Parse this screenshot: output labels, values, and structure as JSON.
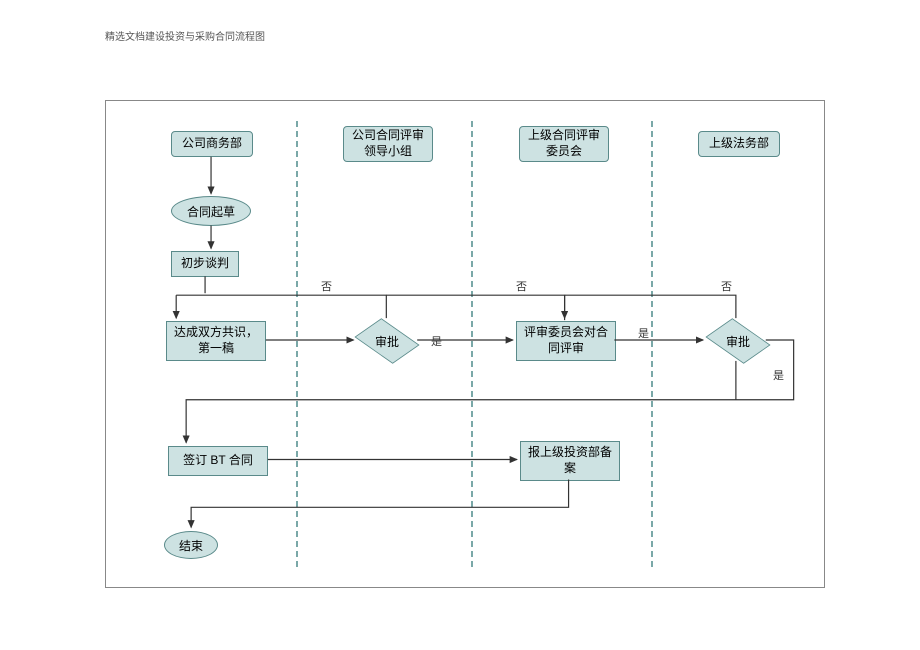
{
  "doc": {
    "title": "精选文档建设投资与采购合同流程图"
  },
  "lanes": {
    "l1": "公司商务部",
    "l2": "公司合同评审领导小组",
    "l3": "上级合同评审委员会",
    "l4": "上级法务部"
  },
  "nodes": {
    "start_draft": "合同起草",
    "initial_neg": "初步谈判",
    "consensus": "达成双方共识，第一稿",
    "approve1": "审批",
    "committee_review": "评审委员会对合同评审",
    "approve2": "审批",
    "sign_bt": "签订 BT 合同",
    "report_filing": "报上级投资部备案",
    "end": "结束"
  },
  "labels": {
    "yes": "是",
    "no": "否"
  },
  "chart_data": {
    "type": "flowchart",
    "title": "精选文档建设投资与采购合同流程图",
    "swimlanes": [
      {
        "id": "l1",
        "name": "公司商务部"
      },
      {
        "id": "l2",
        "name": "公司合同评审领导小组"
      },
      {
        "id": "l3",
        "name": "上级合同评审委员会"
      },
      {
        "id": "l4",
        "name": "上级法务部"
      }
    ],
    "nodes": [
      {
        "id": "lane1_head",
        "lane": "l1",
        "type": "lane-header",
        "label": "公司商务部"
      },
      {
        "id": "lane2_head",
        "lane": "l2",
        "type": "lane-header",
        "label": "公司合同评审领导小组"
      },
      {
        "id": "lane3_head",
        "lane": "l3",
        "type": "lane-header",
        "label": "上级合同评审委员会"
      },
      {
        "id": "lane4_head",
        "lane": "l4",
        "type": "lane-header",
        "label": "上级法务部"
      },
      {
        "id": "start_draft",
        "lane": "l1",
        "type": "terminator",
        "label": "合同起草"
      },
      {
        "id": "initial_neg",
        "lane": "l1",
        "type": "process",
        "label": "初步谈判"
      },
      {
        "id": "consensus",
        "lane": "l1",
        "type": "process",
        "label": "达成双方共识，第一稿"
      },
      {
        "id": "approve1",
        "lane": "l2",
        "type": "decision",
        "label": "审批"
      },
      {
        "id": "committee_review",
        "lane": "l3",
        "type": "process",
        "label": "评审委员会对合同评审"
      },
      {
        "id": "approve2",
        "lane": "l4",
        "type": "decision",
        "label": "审批"
      },
      {
        "id": "sign_bt",
        "lane": "l1",
        "type": "process",
        "label": "签订 BT 合同"
      },
      {
        "id": "report_filing",
        "lane": "l3",
        "type": "process",
        "label": "报上级投资部备案"
      },
      {
        "id": "end",
        "lane": "l1",
        "type": "terminator",
        "label": "结束"
      }
    ],
    "edges": [
      {
        "from": "lane1_head",
        "to": "start_draft"
      },
      {
        "from": "start_draft",
        "to": "initial_neg"
      },
      {
        "from": "initial_neg",
        "to": "consensus"
      },
      {
        "from": "consensus",
        "to": "approve1"
      },
      {
        "from": "approve1",
        "to": "committee_review",
        "label": "是"
      },
      {
        "from": "approve1",
        "to": "initial_neg",
        "label": "否"
      },
      {
        "from": "committee_review",
        "to": "approve2"
      },
      {
        "from": "committee_review",
        "to": "initial_neg",
        "label": "否"
      },
      {
        "from": "approve2",
        "to": "sign_bt",
        "label": "是"
      },
      {
        "from": "approve2",
        "to": "sign_bt",
        "label": "是"
      },
      {
        "from": "approve2",
        "to": "initial_neg",
        "label": "否"
      },
      {
        "from": "sign_bt",
        "to": "report_filing"
      },
      {
        "from": "report_filing",
        "to": "end"
      }
    ]
  }
}
